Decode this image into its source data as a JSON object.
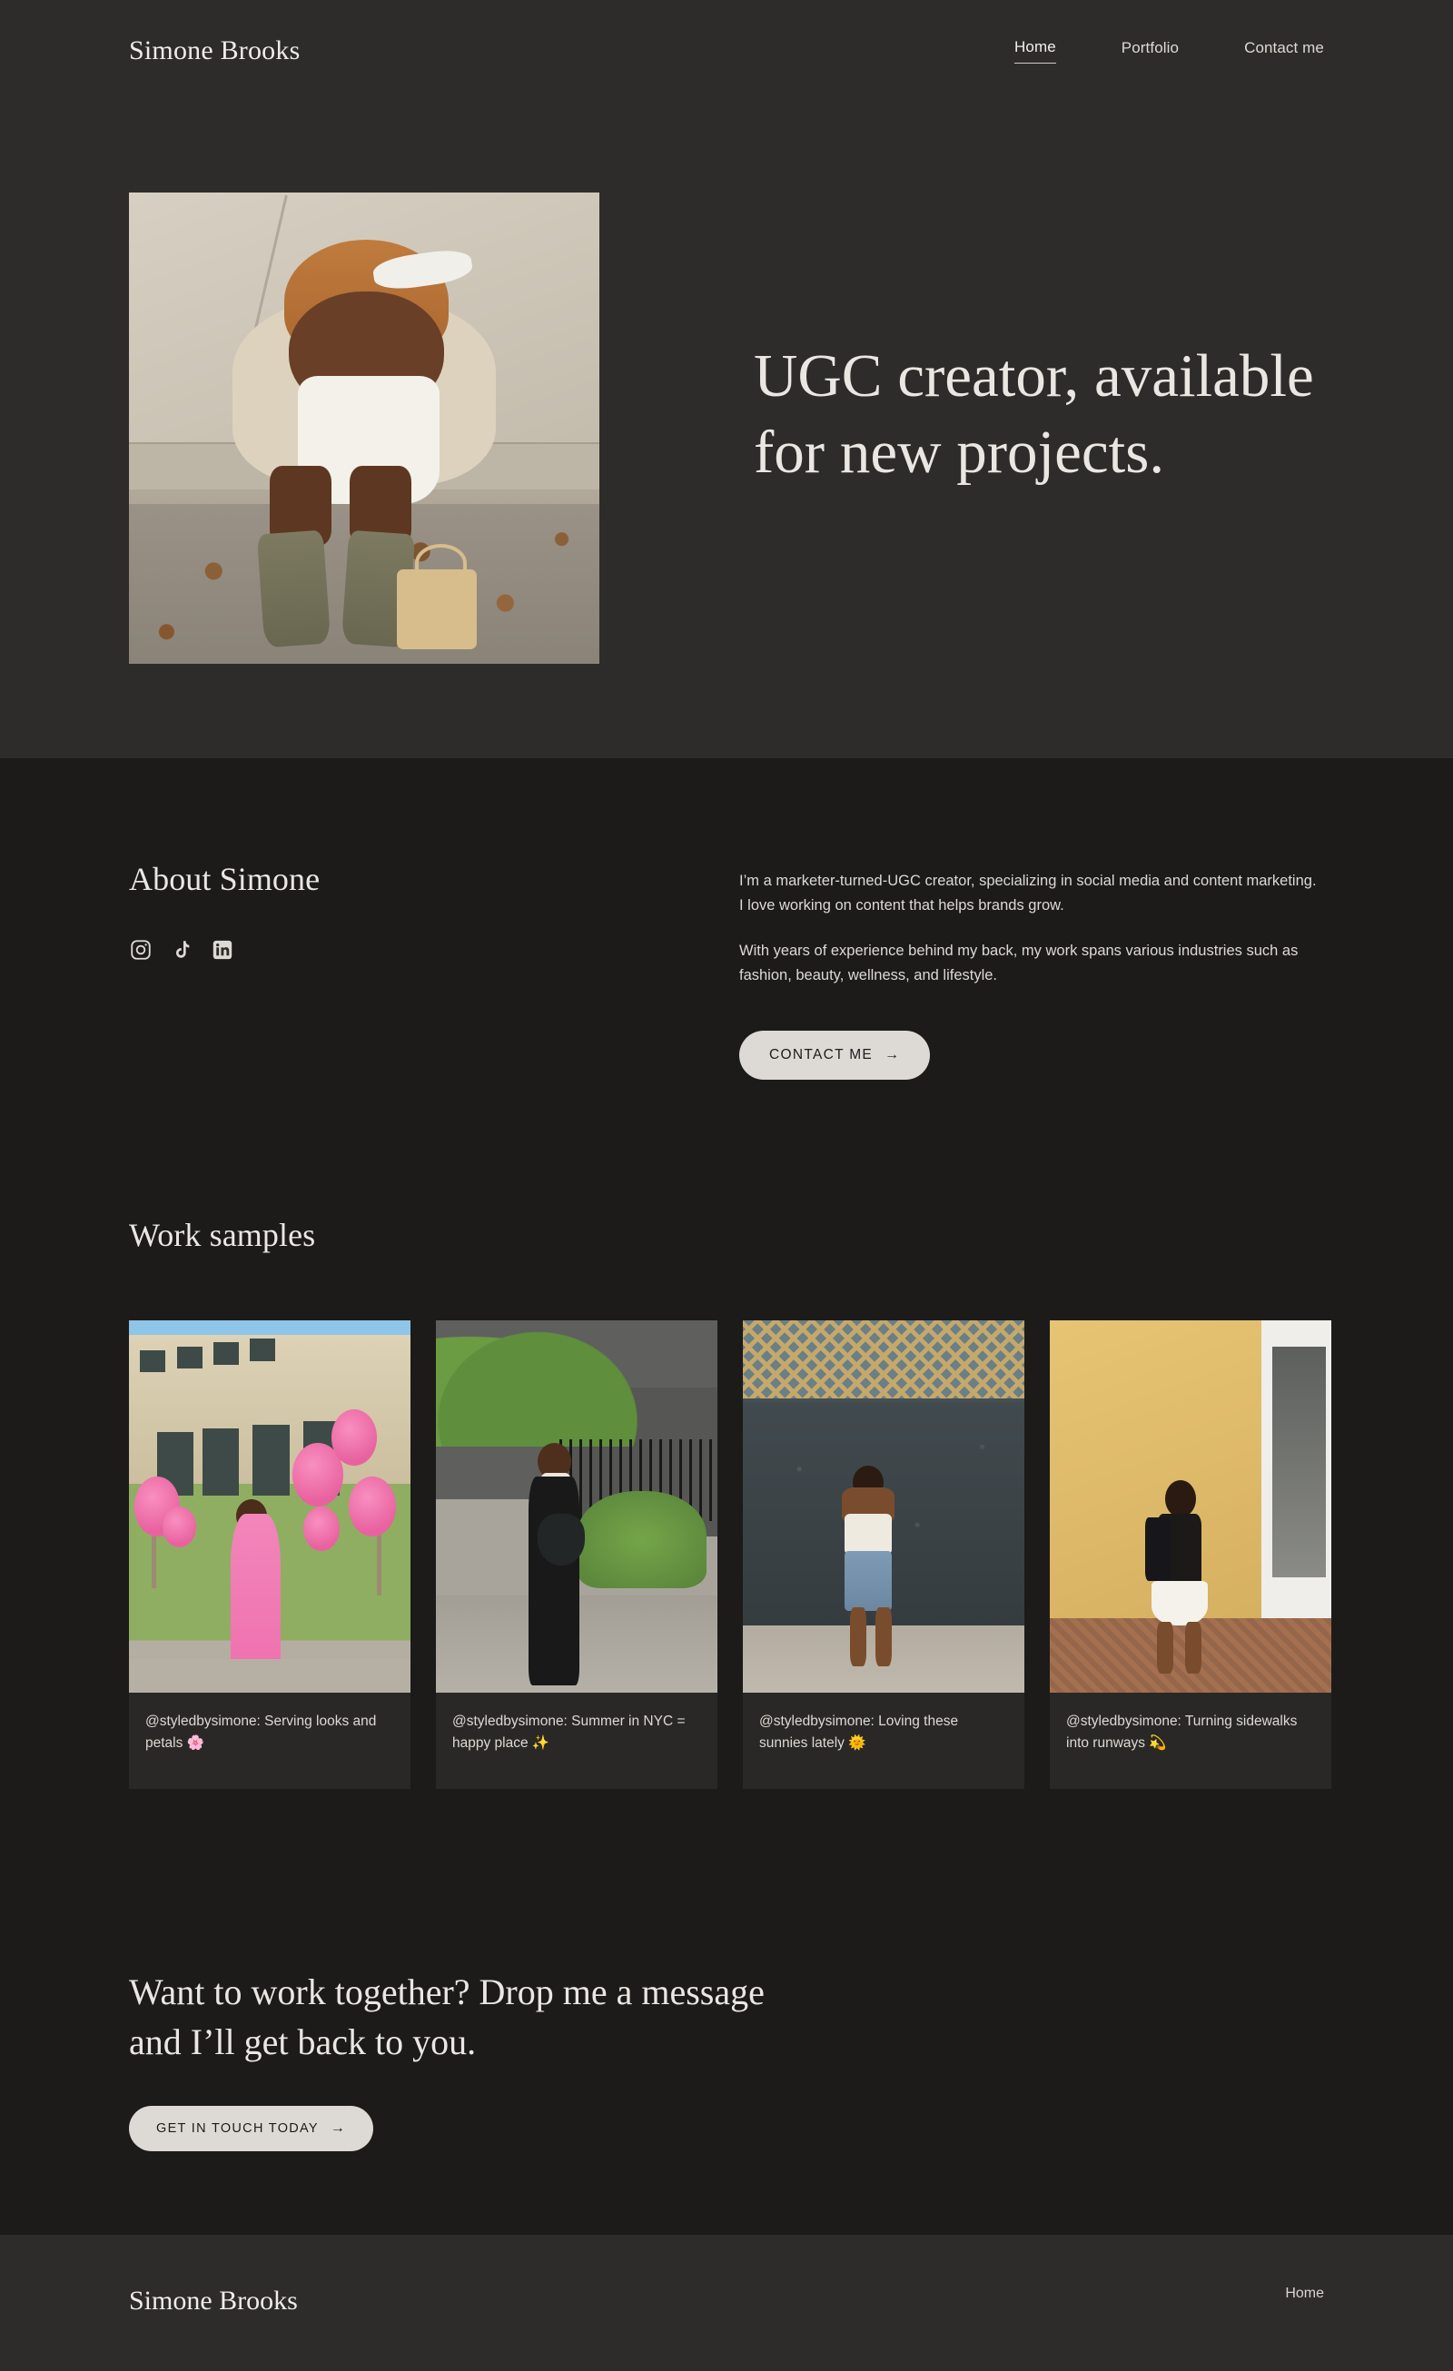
{
  "brand": "Simone Brooks",
  "nav": {
    "items": [
      {
        "label": "Home",
        "active": true
      },
      {
        "label": "Portfolio",
        "active": false
      },
      {
        "label": "Contact me",
        "active": false
      }
    ]
  },
  "hero": {
    "title": "UGC creator, available for new projects.",
    "image_alt": "Simone seated on a curb wearing a white dress, cream knit cardigan, white headband and suede boots"
  },
  "about": {
    "heading": "About Simone",
    "paragraph1": "I’m a marketer-turned-UGC creator, specializing in social media and content marketing. I love working on content that helps brands grow.",
    "paragraph2": "With years of experience behind my back, my work spans various industries such as fashion, beauty, wellness, and lifestyle.",
    "cta_label": "CONTACT ME",
    "cta_arrow": "→",
    "socials": [
      {
        "name": "instagram-icon",
        "label": "Instagram"
      },
      {
        "name": "tiktok-icon",
        "label": "TikTok"
      },
      {
        "name": "linkedin-icon",
        "label": "LinkedIn"
      }
    ]
  },
  "work": {
    "heading": "Work samples",
    "cards": [
      {
        "caption": "@styledbysimone: Serving looks and petals 🌸",
        "image_alt": "Pink maxi dress in front of a building with blooming crepe myrtles"
      },
      {
        "caption": "@styledbysimone: Summer in NYC = happy place ✨",
        "image_alt": "Black maxi skirt with a leather shoulder bag beside a green hedge"
      },
      {
        "caption": "@styledbysimone: Loving these sunnies lately 🌞",
        "image_alt": "White tube top and denim shorts against a dark granite wall"
      },
      {
        "caption": "@styledbysimone: Turning sidewalks into runways 💫",
        "image_alt": "Black top and white skirt walking past a yellow stucco wall"
      }
    ]
  },
  "cta": {
    "heading": "Want to work together? Drop me a message and I’ll get back to you.",
    "button_label": "GET IN TOUCH TODAY",
    "button_arrow": "→"
  },
  "footer": {
    "brand": "Simone Brooks",
    "links": [
      {
        "label": "Home"
      }
    ]
  },
  "colors": {
    "page_bg": "#1c1b1a",
    "band_bg": "#2e2c2a",
    "card_caption_bg": "#2a2826",
    "text": "#ddd9d4",
    "heading": "#eae7e2",
    "button_bg": "#dddad6",
    "button_text": "#1d1c1b"
  }
}
